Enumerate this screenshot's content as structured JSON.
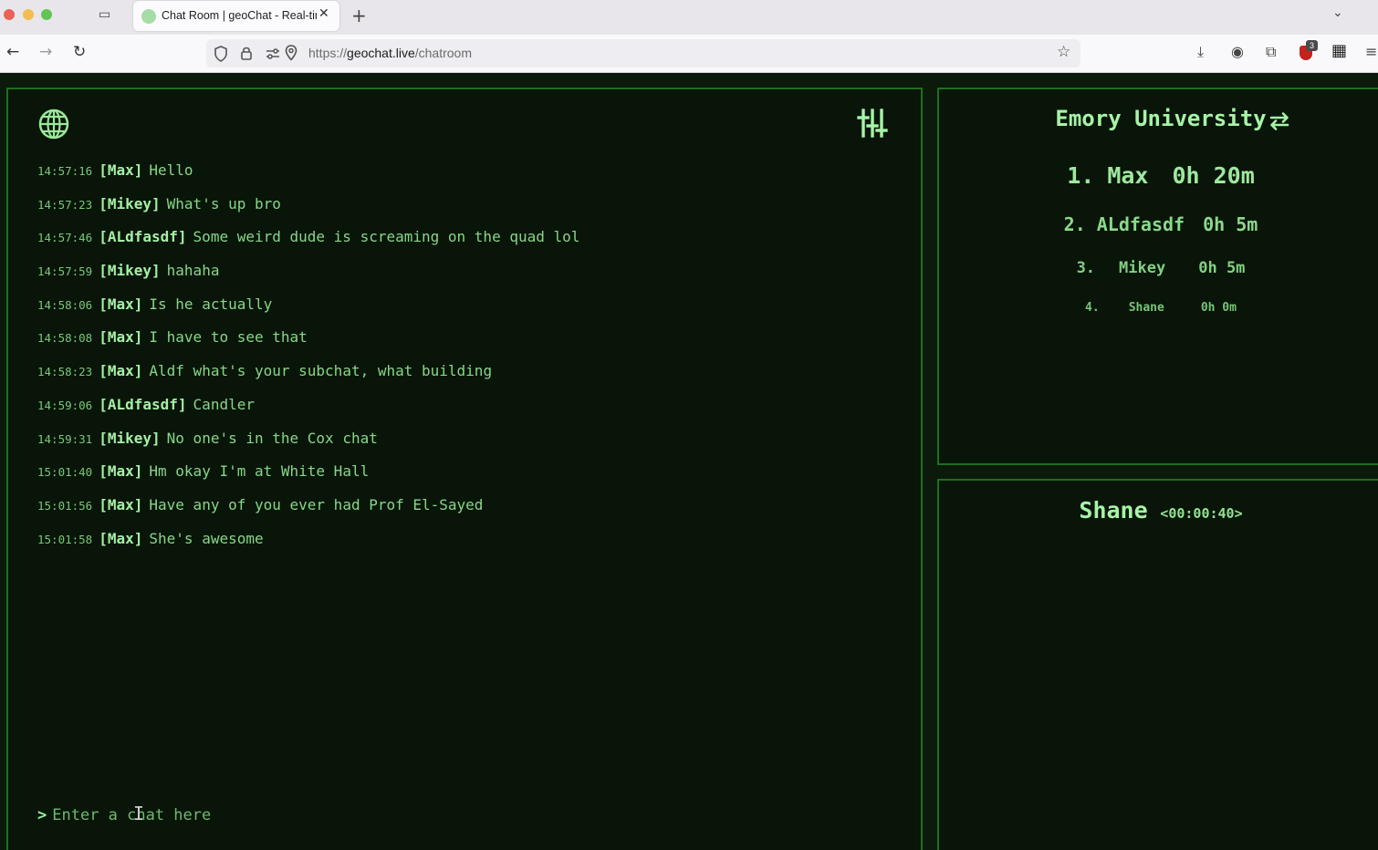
{
  "browser": {
    "tab_title": "Chat Room | geoChat - Real-tim",
    "url_scheme": "https://",
    "url_host": "geochat.live",
    "url_path": "/chatroom",
    "extension_badge": "3"
  },
  "icons": {
    "globe": "globe-icon",
    "settings": "sliders-icon",
    "swap": "swap-icon",
    "new_tab": "+",
    "tab_close": "✕",
    "back": "←",
    "forward": "→",
    "reload": "↻",
    "star": "☆",
    "download": "⤓",
    "account": "◉",
    "extensions": "⧉",
    "apps": "▦",
    "menu": "≡",
    "tab_list": "⌄",
    "tab_overview": "▭"
  },
  "colors": {
    "background": "#0b1a0b",
    "panel_border": "#1f6f1f",
    "text_green": "#8fe08f",
    "highlight_green": "#a7f3a7"
  },
  "chat": {
    "messages": [
      {
        "time": "14:57:16",
        "user": "[Max]",
        "text": "Hello"
      },
      {
        "time": "14:57:23",
        "user": "[Mikey]",
        "text": "What's up bro"
      },
      {
        "time": "14:57:46",
        "user": "[ALdfasdf]",
        "text": "Some weird dude is screaming on the quad lol"
      },
      {
        "time": "14:57:59",
        "user": "[Mikey]",
        "text": "hahaha"
      },
      {
        "time": "14:58:06",
        "user": "[Max]",
        "text": "Is he actually"
      },
      {
        "time": "14:58:08",
        "user": "[Max]",
        "text": "I have to see that"
      },
      {
        "time": "14:58:23",
        "user": "[Max]",
        "text": "Aldf what's your subchat, what building"
      },
      {
        "time": "14:59:06",
        "user": "[ALdfasdf]",
        "text": "Candler"
      },
      {
        "time": "14:59:31",
        "user": "[Mikey]",
        "text": "No one's in the Cox chat"
      },
      {
        "time": "15:01:40",
        "user": "[Max]",
        "text": "Hm okay I'm at White Hall"
      },
      {
        "time": "15:01:56",
        "user": "[Max]",
        "text": "Have any of you ever had Prof El-Sayed"
      },
      {
        "time": "15:01:58",
        "user": "[Max]",
        "text": "She's awesome"
      }
    ],
    "prompt_symbol": ">",
    "input_placeholder": "Enter a chat here"
  },
  "leaderboard": {
    "title": "Emory University",
    "entries": [
      {
        "rank": "1.",
        "name": "Max",
        "time": "0h 20m"
      },
      {
        "rank": "2.",
        "name": "ALdfasdf",
        "time": "0h 5m"
      },
      {
        "rank": "3.",
        "name": "Mikey",
        "time": "0h 5m"
      },
      {
        "rank": "4.",
        "name": "Shane",
        "time": "0h 0m"
      }
    ]
  },
  "current_user": {
    "name": "Shane",
    "timer": "<00:00:40>"
  }
}
